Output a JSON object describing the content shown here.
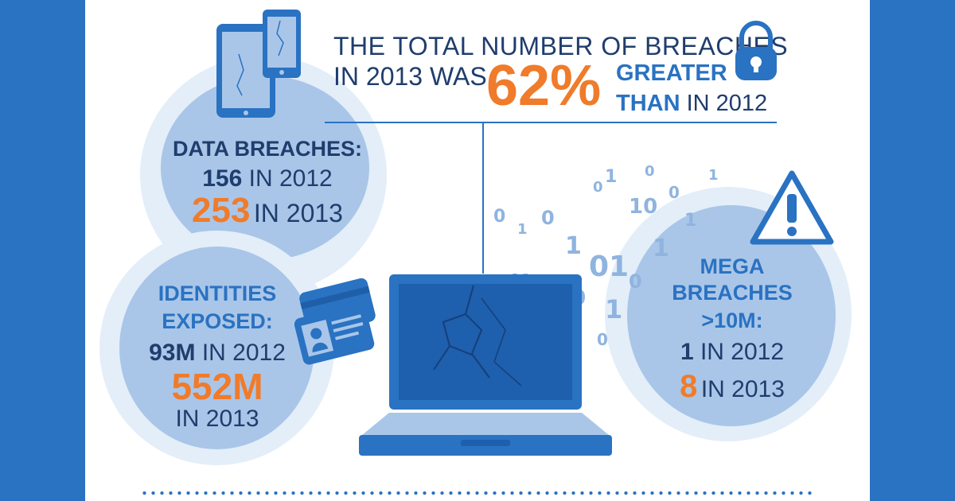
{
  "headline": {
    "line1": "THE TOTAL NUMBER OF BREACHES",
    "line2": "IN 2013 WAS",
    "percent": "62%",
    "greater": "GREATER",
    "than": "THAN",
    "in_2012": "IN 2012"
  },
  "data_breaches": {
    "title": "DATA BREACHES:",
    "v2012": "156",
    "l2012": "IN 2012",
    "v2013": "253",
    "l2013": "IN 2013"
  },
  "identities": {
    "title1": "IDENTITIES",
    "title2": "EXPOSED:",
    "v2012": "93M",
    "l2012": "IN 2012",
    "v2013": "552M",
    "l2013": "IN 2013"
  },
  "mega": {
    "title1": "MEGA",
    "title2": "BREACHES",
    "title3": ">10M:",
    "v2012": "1",
    "l2012": "IN 2012",
    "v2013": "8",
    "l2013": "IN 2013"
  },
  "icons": [
    "phone-tablet-icon",
    "padlock-icon",
    "id-card-icon",
    "laptop-icon",
    "warning-icon"
  ],
  "colors": {
    "navy": "#1f3d6d",
    "orange": "#f07b2a",
    "blue": "#2a72c2",
    "circle": "#a9c6e8",
    "halo": "#e3eef9"
  }
}
